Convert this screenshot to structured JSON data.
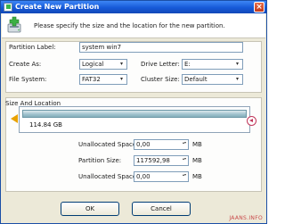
{
  "window": {
    "title": "Create New Partition",
    "close_glyph": "×"
  },
  "header": {
    "text": "Please specify the size and the location for the new partition."
  },
  "form": {
    "partition_label": {
      "label": "Partition Label:",
      "value": "system win7"
    },
    "create_as": {
      "label": "Create As:",
      "value": "Logical"
    },
    "drive_letter": {
      "label": "Drive Letter:",
      "value": "E:"
    },
    "file_system": {
      "label": "File System:",
      "value": "FAT32"
    },
    "cluster_size": {
      "label": "Cluster Size:",
      "value": "Default"
    }
  },
  "size_location": {
    "group_title": "Size And Location",
    "bar_label": "114.84 GB",
    "unallocated_before": {
      "label": "Unallocated Space Before:",
      "value": "0,00",
      "unit": "MB"
    },
    "partition_size": {
      "label": "Partition Size:",
      "value": "117592,98",
      "unit": "MB"
    },
    "unallocated_after": {
      "label": "Unallocated Space After:",
      "value": "0,00",
      "unit": "MB"
    }
  },
  "buttons": {
    "ok": "OK",
    "cancel": "Cancel"
  },
  "watermark": "JAANS.INFO",
  "icons": {
    "dropdown": "▾",
    "spin": "▴▾"
  },
  "colors": {
    "title_bar": "#1659d8",
    "bar_fill": "#9ec1cc",
    "handle_left": "#e9a200",
    "handle_right": "#c0365a"
  }
}
